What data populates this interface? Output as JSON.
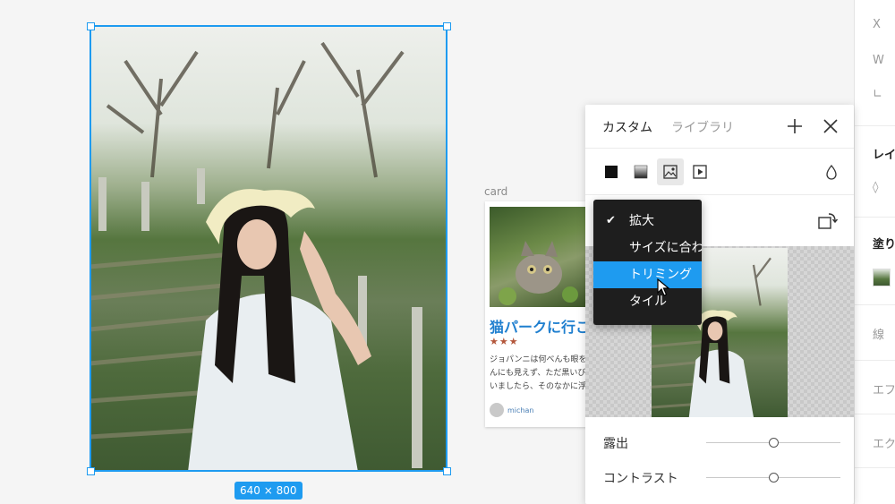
{
  "canvas": {
    "selection_size": "640 × 800",
    "card": {
      "label": "card",
      "title": "猫パークに行こ",
      "stars": "★★★",
      "text_lines": [
        "ジョパンニは何べんも眼を",
        "んにも見えず、ただ黒いび",
        "いましたら、そのなかに浮"
      ],
      "author": "michan"
    }
  },
  "fill_panel": {
    "tabs": [
      {
        "label": "カスタム",
        "active": true
      },
      {
        "label": "ライブラリ",
        "active": false
      }
    ],
    "fill_types": [
      "solid",
      "gradient",
      "image",
      "video"
    ],
    "active_fill_type": "image",
    "sliders": [
      {
        "label": "露出",
        "value": 0.5
      },
      {
        "label": "コントラスト",
        "value": 0.5
      }
    ]
  },
  "dropdown": {
    "items": [
      {
        "label": "拡大",
        "checked": true,
        "highlighted": false
      },
      {
        "label": "サイズに合わせる",
        "checked": false,
        "highlighted": false
      },
      {
        "label": "トリミング",
        "checked": false,
        "highlighted": true
      },
      {
        "label": "タイル",
        "checked": false,
        "highlighted": false
      }
    ]
  },
  "inspector": {
    "x_label": "X",
    "w_label": "W",
    "angle_label": "∟",
    "layer_label": "レイ",
    "fill_label": "塗り",
    "stroke_label": "線",
    "effect_label": "エフ",
    "export_label": "エク"
  },
  "colors": {
    "accent": "#1e9bf0",
    "menu_bg": "#1e1e1e",
    "card_title": "#1f7fcf",
    "stars": "#b3563a"
  }
}
